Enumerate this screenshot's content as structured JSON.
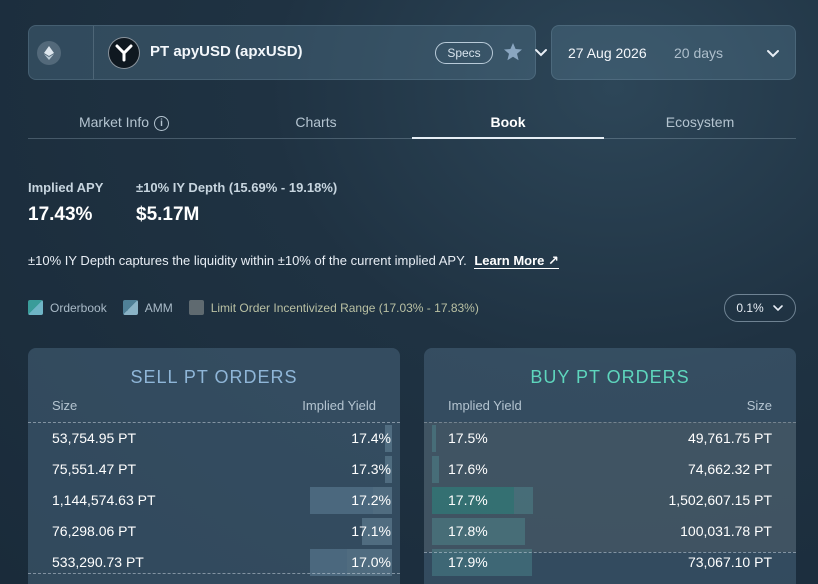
{
  "header": {
    "market_name": "PT apyUSD (apxUSD)",
    "specs_label": "Specs",
    "chain_icon": "ethereum-icon",
    "logo_icon": "y-logo-icon"
  },
  "date_selector": {
    "date": "27 Aug 2026",
    "days": "20 days"
  },
  "tabs": [
    {
      "label": "Market Info",
      "active": false
    },
    {
      "label": "Charts",
      "active": false
    },
    {
      "label": "Book",
      "active": true
    },
    {
      "label": "Ecosystem",
      "active": false
    }
  ],
  "stats": {
    "implied_apy_label": "Implied APY",
    "implied_apy_value": "17.43%",
    "depth_label": "±10% IY Depth (15.69% - 19.18%)",
    "depth_value": "$5.17M"
  },
  "description": {
    "text": "±10% IY Depth captures the liquidity within ±10% of the current implied APY.",
    "link": "Learn More"
  },
  "legend": {
    "orderbook": "Orderbook",
    "amm": "AMM",
    "limit": "Limit Order Incentivized Range (17.03% - 17.83%)"
  },
  "tick_size": "0.1%",
  "sell_panel": {
    "title": "SELL PT ORDERS",
    "col_size": "Size",
    "col_yield": "Implied Yield",
    "rows": [
      {
        "size": "53,754.95 PT",
        "yield": "17.4%",
        "ob": 0.0,
        "amm": 0.02
      },
      {
        "size": "75,551.47 PT",
        "yield": "17.3%",
        "ob": 0.0,
        "amm": 0.02
      },
      {
        "size": "1,144,574.63 PT",
        "yield": "17.2%",
        "ob": 0.17,
        "amm": 0.05
      },
      {
        "size": "76,298.06 PT",
        "yield": "17.1%",
        "ob": 0.0,
        "amm": 0.08
      },
      {
        "size": "533,290.73 PT",
        "yield": "17.0%",
        "ob": 0.1,
        "amm": 0.12
      }
    ]
  },
  "buy_panel": {
    "title": "BUY PT ORDERS",
    "col_yield": "Implied Yield",
    "col_size": "Size",
    "rows": [
      {
        "yield": "17.5%",
        "size": "49,761.75 PT",
        "ob": 0.0,
        "amm": 0.01
      },
      {
        "yield": "17.6%",
        "size": "74,662.32 PT",
        "ob": 0.0,
        "amm": 0.02
      },
      {
        "yield": "17.7%",
        "size": "1,502,607.15 PT",
        "ob": 0.22,
        "amm": 0.05
      },
      {
        "yield": "17.8%",
        "size": "100,031.78 PT",
        "ob": 0.0,
        "amm": 0.25
      },
      {
        "yield": "17.9%",
        "size": "73,067.10 PT",
        "ob": 0.0,
        "amm": 0.27
      }
    ]
  }
}
